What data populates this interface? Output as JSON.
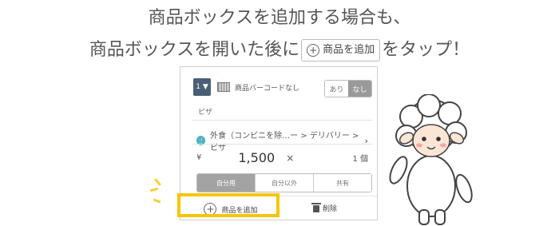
{
  "heading": {
    "line1": "商品ボックスを追加する場合も、",
    "line2_before": "商品ボックスを開いた後に",
    "line2_button": "商品を追加",
    "line2_after": "をタップ！"
  },
  "card": {
    "box_number": "1",
    "barcode_label": "商品バーコードなし",
    "barcode_toggle": [
      "あり",
      "なし"
    ],
    "item_name": "ピザ",
    "category_path": "外食（コンビニを除…ー > デリバリー > ピザ",
    "price_currency": "¥",
    "price": "1,500",
    "multiply": "×",
    "quantity": "1 個",
    "segments": [
      "自分用",
      "自分以外",
      "共有"
    ],
    "add_button": "商品を追加",
    "delete_button": "削除"
  },
  "colors": {
    "highlight": "#f6c600",
    "accent": "#40b4c8",
    "box": "#4a5e77"
  }
}
